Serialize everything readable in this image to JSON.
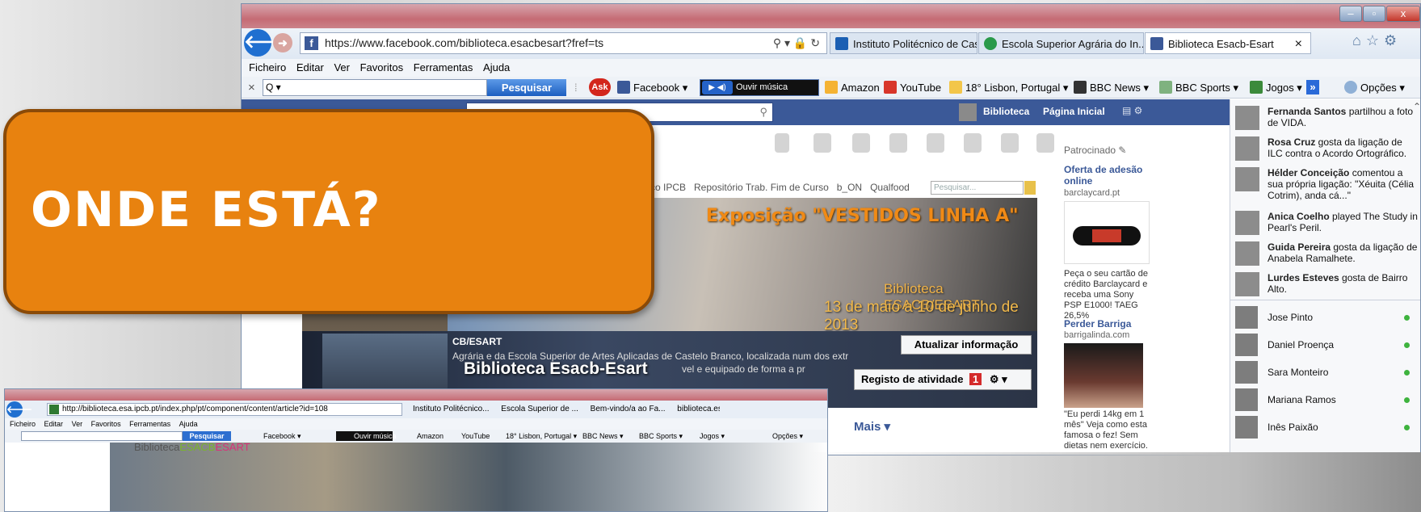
{
  "main_window": {
    "url": "https://www.facebook.com/biblioteca.esacbesart?fref=ts",
    "tabs": [
      {
        "label": "Instituto Politécnico de Caste...",
        "active": false
      },
      {
        "label": "Escola Superior Agrária do In...",
        "active": false
      },
      {
        "label": "Biblioteca Esacb-Esart",
        "active": true
      }
    ],
    "tab_close": "×",
    "menu": [
      "Ficheiro",
      "Editar",
      "Ver",
      "Favoritos",
      "Ferramentas",
      "Ajuda"
    ],
    "toolbar": {
      "close": "×",
      "search_prefix": "Q ▾",
      "search_button": "Pesquisar",
      "ask": "Ask",
      "facebook": "Facebook ▾",
      "music": "Ouvir música",
      "amazon": "Amazon",
      "youtube": "YouTube",
      "weather": "18° Lisbon, Portugal ▾",
      "bbc_news": "BBC News ▾",
      "bbc_sports": "BBC Sports ▾",
      "jogos": "Jogos ▾",
      "more": "»",
      "options": "Opções ▾"
    },
    "fb": {
      "nav_biblioteca": "Biblioteca",
      "nav_pagina": "Página Inicial",
      "links": "fico IPCB   Repositório Trab. Fim de Curso   b_ON   Qualfood",
      "search_placeholder": "Pesquisar...",
      "banner_title": "Exposição \"VESTIDOS LINHA A\"",
      "banner_place": "Biblioteca ESACB/ESART",
      "banner_dates": "13 de maio a 10 de junho de 2013",
      "update_button": "Atualizar informação",
      "activity_button": "Registo de atividade",
      "activity_count": "1",
      "desc_head": "CB/ESART",
      "desc_line1": "Agrária e da Escola Superior de Artes Aplicadas de Castelo Branco, localizada num dos extremos do edifício",
      "desc_line2": "vel e equipado de forma a pr",
      "page_name": "Biblioteca Esacb-Esart",
      "mais": "Mais ▾",
      "sponsored": "Patrocinado",
      "ad1_title": "Oferta de adesão online",
      "ad1_domain": "barclaycard.pt",
      "ad1_text": "Peça o seu cartão de crédito Barclaycard e receba uma Sony PSP E1000! TAEG 26,5%",
      "ad2_title": "Perder Barriga",
      "ad2_domain": "barrigalinda.com",
      "ad2_text": "\"Eu perdi 14kg em 1 mês\" Veja como esta famosa o fez! Sem dietas nem exercício."
    },
    "ticker": [
      {
        "name": "Fernanda Santos",
        "text": " partilhou a foto de VIDA."
      },
      {
        "name": "Rosa Cruz",
        "text": " gosta da ligação de ILC contra o Acordo Ortográfico."
      },
      {
        "name": "Hélder Conceição",
        "text": " comentou a sua própria ligação: \"Xéuita (Célia Cotrim), anda cá...\""
      },
      {
        "name": "Anica Coelho",
        "text": " played The Study in Pearl's Peril."
      },
      {
        "name": "Guida Pereira",
        "text": " gosta da ligação de Anabela Ramalhete."
      },
      {
        "name": "Lurdes Esteves",
        "text": " gosta de Bairro Alto."
      }
    ],
    "chat": [
      "Jose Pinto",
      "Daniel Proença",
      "Sara Monteiro",
      "Mariana Ramos",
      "Inês Paixão"
    ]
  },
  "second_window": {
    "url": "http://biblioteca.esa.ipcb.pt/index.php/pt/component/content/article?id=108",
    "tabs": [
      {
        "label": "Instituto Politécnico..."
      },
      {
        "label": "Escola Superior de ..."
      },
      {
        "label": "Bem-vindo/a ao Fa..."
      },
      {
        "label": "biblioteca.esa"
      }
    ],
    "tab_close": "×",
    "menu": [
      "Ficheiro",
      "Editar",
      "Ver",
      "Favoritos",
      "Ferramentas",
      "Ajuda"
    ],
    "toolbar": {
      "search_button": "Pesquisar",
      "facebook": "Facebook ▾",
      "music": "Ouvir música",
      "amazon": "Amazon",
      "youtube": "YouTube",
      "weather": "18° Lisbon, Portugal ▾",
      "bbc_news": "BBC News ▾",
      "bbc_sports": "BBC Sports ▾",
      "jogos": "Jogos ▾",
      "options": "Opções ▾"
    },
    "logo_a": "Biblioteca",
    "logo_b": "ESACB",
    "logo_c": "ESART"
  },
  "callout": {
    "text": "ONDE ESTÁ?"
  },
  "colors": {
    "orange": "#e8820f",
    "fb_blue": "#3b5998",
    "ie_blue": "#1f6fd0"
  }
}
